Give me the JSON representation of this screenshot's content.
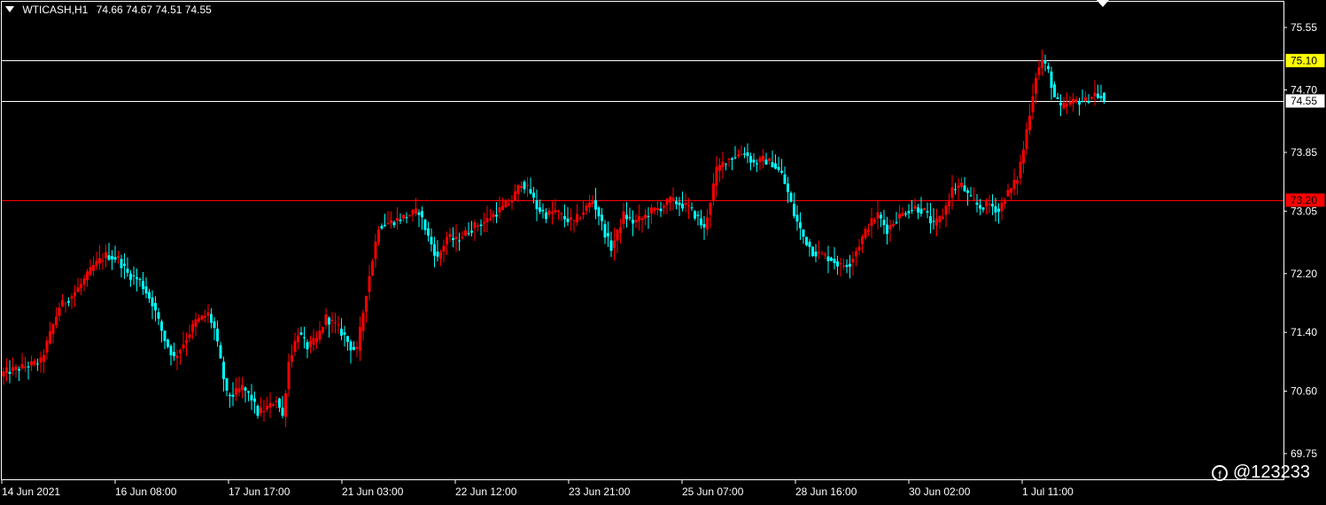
{
  "header": {
    "symbol": "WTICASH,H1",
    "ohlc": "74.66 74.67 74.51 74.55"
  },
  "watermark": "@123233",
  "colors": {
    "background": "#000000",
    "up_candle": "#ff0000",
    "down_candle": "#00ffff",
    "axis": "#ffffff",
    "line_75_10": "#ffffff",
    "line_74_55": "#ffffff",
    "line_73_20": "#ff0000",
    "tag_75_10": "#ffff00",
    "tag_74_55": "#ffffff",
    "tag_73_20": "#ff0000"
  },
  "chart_data": {
    "type": "candlestick",
    "symbol": "WTICASH",
    "timeframe": "H1",
    "ylim": [
      69.4,
      75.9
    ],
    "y_ticks": [
      "75.55",
      "74.70",
      "73.85",
      "73.05",
      "72.20",
      "71.40",
      "70.60",
      "69.75"
    ],
    "x_ticks": [
      "14 Jun 2021",
      "16 Jun 08:00",
      "17 Jun 17:00",
      "21 Jun 03:00",
      "22 Jun 12:00",
      "23 Jun 21:00",
      "25 Jun 07:00",
      "28 Jun 16:00",
      "30 Jun 02:00",
      "1 Jul 11:00"
    ],
    "horizontal_lines": [
      {
        "value": 75.1,
        "label": "75.10",
        "color": "#ffffff",
        "tag_bg": "#ffff00",
        "tag_fg": "#000000"
      },
      {
        "value": 74.55,
        "label": "74.55",
        "color": "#ffffff",
        "tag_bg": "#ffffff",
        "tag_fg": "#000000"
      },
      {
        "value": 73.2,
        "label": "73.20",
        "color": "#ff0000",
        "tag_bg": "#ff0000",
        "tag_fg": "#ff0000"
      }
    ],
    "close_anchors": [
      [
        0,
        70.85
      ],
      [
        8,
        70.95
      ],
      [
        12,
        71.0
      ],
      [
        14,
        71.25
      ],
      [
        18,
        71.75
      ],
      [
        22,
        71.9
      ],
      [
        25,
        72.05
      ],
      [
        29,
        72.3
      ],
      [
        33,
        72.45
      ],
      [
        37,
        72.4
      ],
      [
        40,
        72.2
      ],
      [
        44,
        72.1
      ],
      [
        48,
        71.8
      ],
      [
        52,
        71.3
      ],
      [
        55,
        71.05
      ],
      [
        58,
        71.25
      ],
      [
        62,
        71.55
      ],
      [
        66,
        71.65
      ],
      [
        68,
        71.45
      ],
      [
        70,
        71.0
      ],
      [
        72,
        70.55
      ],
      [
        74,
        70.55
      ],
      [
        77,
        70.65
      ],
      [
        80,
        70.5
      ],
      [
        82,
        70.3
      ],
      [
        86,
        70.4
      ],
      [
        88,
        70.5
      ],
      [
        90,
        70.25
      ],
      [
        92,
        71.0
      ],
      [
        95,
        71.4
      ],
      [
        98,
        71.2
      ],
      [
        101,
        71.3
      ],
      [
        104,
        71.6
      ],
      [
        107,
        71.5
      ],
      [
        110,
        71.35
      ],
      [
        112,
        71.2
      ],
      [
        114,
        71.15
      ],
      [
        117,
        71.95
      ],
      [
        121,
        72.85
      ],
      [
        125,
        72.9
      ],
      [
        128,
        72.95
      ],
      [
        131,
        73.0
      ],
      [
        134,
        73.05
      ],
      [
        137,
        72.7
      ],
      [
        140,
        72.4
      ],
      [
        143,
        72.7
      ],
      [
        146,
        72.65
      ],
      [
        149,
        72.75
      ],
      [
        152,
        72.85
      ],
      [
        155,
        72.9
      ],
      [
        158,
        73.0
      ],
      [
        161,
        73.1
      ],
      [
        164,
        73.2
      ],
      [
        167,
        73.45
      ],
      [
        170,
        73.3
      ],
      [
        172,
        73.1
      ],
      [
        175,
        73.0
      ],
      [
        178,
        73.05
      ],
      [
        181,
        72.95
      ],
      [
        184,
        72.9
      ],
      [
        187,
        73.05
      ],
      [
        190,
        73.2
      ],
      [
        192,
        73.0
      ],
      [
        194,
        72.75
      ],
      [
        196,
        72.55
      ],
      [
        198,
        72.75
      ],
      [
        200,
        73.0
      ],
      [
        203,
        72.9
      ],
      [
        206,
        72.95
      ],
      [
        209,
        73.05
      ],
      [
        212,
        73.1
      ],
      [
        215,
        73.2
      ],
      [
        218,
        73.15
      ],
      [
        221,
        73.1
      ],
      [
        224,
        72.95
      ],
      [
        226,
        72.8
      ],
      [
        228,
        73.2
      ],
      [
        230,
        73.6
      ],
      [
        233,
        73.75
      ],
      [
        236,
        73.8
      ],
      [
        239,
        73.85
      ],
      [
        242,
        73.7
      ],
      [
        245,
        73.75
      ],
      [
        248,
        73.7
      ],
      [
        251,
        73.55
      ],
      [
        253,
        73.3
      ],
      [
        255,
        73.0
      ],
      [
        258,
        72.7
      ],
      [
        261,
        72.5
      ],
      [
        264,
        72.45
      ],
      [
        267,
        72.4
      ],
      [
        270,
        72.3
      ],
      [
        273,
        72.35
      ],
      [
        276,
        72.6
      ],
      [
        279,
        72.85
      ],
      [
        282,
        73.0
      ],
      [
        285,
        72.8
      ],
      [
        288,
        72.95
      ],
      [
        291,
        73.05
      ],
      [
        294,
        73.1
      ],
      [
        297,
        73.05
      ],
      [
        300,
        72.85
      ],
      [
        303,
        73.0
      ],
      [
        306,
        73.35
      ],
      [
        309,
        73.4
      ],
      [
        312,
        73.2
      ],
      [
        315,
        73.1
      ],
      [
        318,
        73.15
      ],
      [
        321,
        73.05
      ],
      [
        323,
        73.25
      ],
      [
        325,
        73.35
      ],
      [
        327,
        73.5
      ],
      [
        329,
        73.9
      ],
      [
        331,
        74.4
      ],
      [
        333,
        74.9
      ],
      [
        335,
        75.1
      ],
      [
        337,
        74.95
      ],
      [
        339,
        74.6
      ],
      [
        341,
        74.45
      ],
      [
        343,
        74.5
      ],
      [
        346,
        74.55
      ],
      [
        349,
        74.55
      ],
      [
        352,
        74.65
      ],
      [
        355,
        74.55
      ]
    ],
    "last": {
      "open": 74.66,
      "high": 74.67,
      "low": 74.51,
      "close": 74.55
    }
  }
}
